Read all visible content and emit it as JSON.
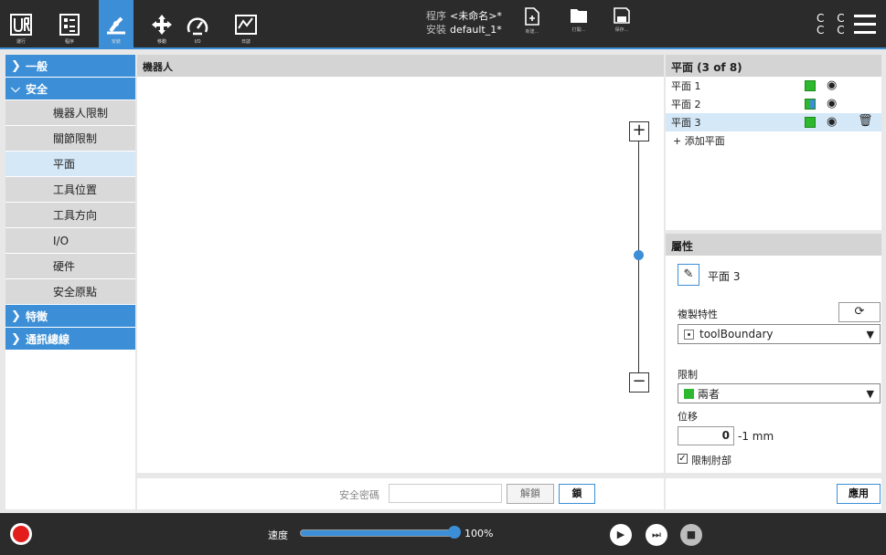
{
  "topnav": {
    "run": "運行",
    "program": "程序",
    "installation": "安裝",
    "move": "移動",
    "io": "I/O",
    "log": "日誌"
  },
  "file": {
    "program_key": "程序",
    "program_value": "<未命名>*",
    "install_key": "安裝",
    "install_value": "default_1*",
    "new_label": "新建...",
    "open_label": "打開...",
    "save_label": "保存..."
  },
  "status_cc": [
    "C C",
    "C C"
  ],
  "sidebar": {
    "general": "一般",
    "safety": "安全",
    "safety_items": [
      "機器人限制",
      "關節限制",
      "平面",
      "工具位置",
      "工具方向",
      "I/O",
      "硬件",
      "安全原點"
    ],
    "selected_index": 2,
    "features": "特徵",
    "comm": "通訊總線"
  },
  "center": {
    "title": "機器人",
    "zoom_in": "+",
    "zoom_out": "−",
    "password_label": "安全密碼",
    "unlock_label": "解鎖",
    "lock_label": "鎖"
  },
  "planes": {
    "header": "平面 (3 of 8)",
    "items": [
      "平面 1",
      "平面 2",
      "平面 3"
    ],
    "selected_index": 2,
    "add_label": "+ 添加平面"
  },
  "properties": {
    "header": "屬性",
    "name": "平面 3",
    "copy_label": "複製特性",
    "copy_value": "toolBoundary",
    "restrict_label": "限制",
    "restrict_value": "兩者",
    "offset_label": "位移",
    "offset_value": "0",
    "offset_unit": "-1 mm",
    "elbow_label": "限制肘部",
    "elbow_checked": true,
    "apply_label": "應用"
  },
  "bottombar": {
    "speed_label": "速度",
    "speed_value": "100%",
    "speed_fraction": 1.0
  },
  "colors": {
    "accent": "#3c8fd6",
    "topbar": "#2b2b2b",
    "record": "#e31c1c",
    "restrict_green": "#2eb82e"
  }
}
